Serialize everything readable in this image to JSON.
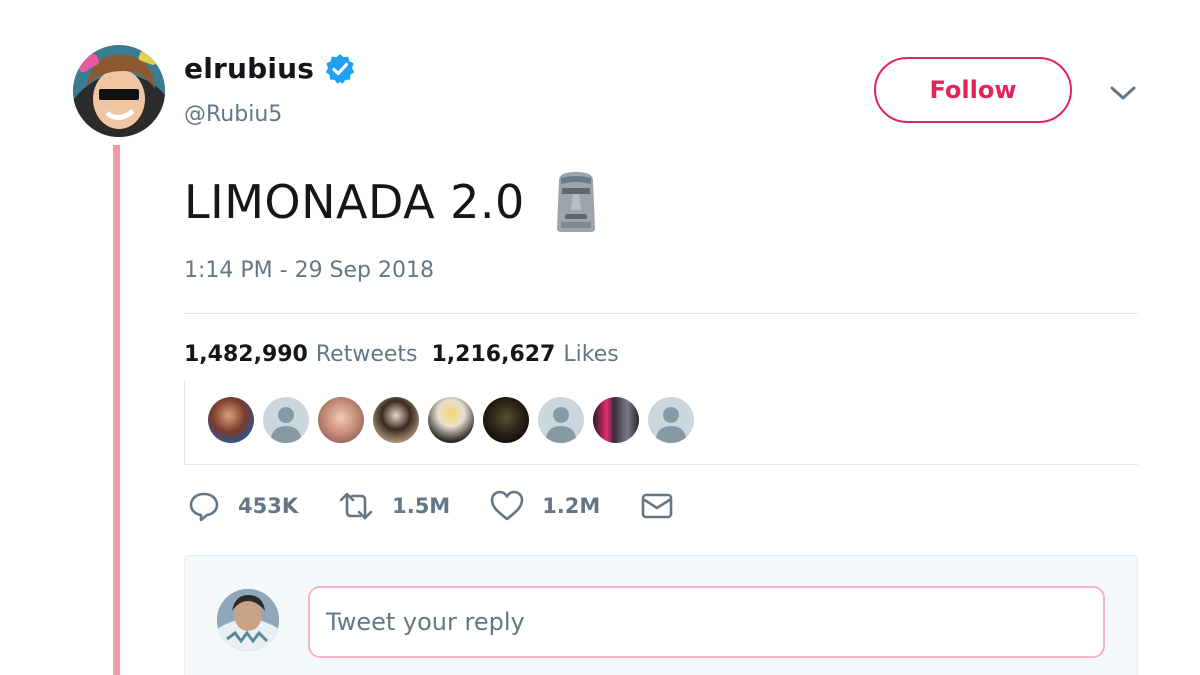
{
  "user": {
    "display_name": "elrubius",
    "handle": "@Rubiu5",
    "verified": true
  },
  "header": {
    "follow_label": "Follow"
  },
  "tweet": {
    "text": "LIMONADA 2.0",
    "emoji": "moai-icon",
    "timestamp": "1:14 PM - 29 Sep 2018"
  },
  "stats": {
    "retweets_count": "1,482,990",
    "retweets_label": "Retweets",
    "likes_count": "1,216,627",
    "likes_label": "Likes"
  },
  "actions": {
    "replies": "453K",
    "retweets": "1.5M",
    "likes": "1.2M"
  },
  "reply": {
    "placeholder": "Tweet your reply"
  },
  "colors": {
    "accent": "#e0245e",
    "verified": "#1da1f2",
    "thread_line": "#f59aaa",
    "muted_text": "#657786"
  }
}
